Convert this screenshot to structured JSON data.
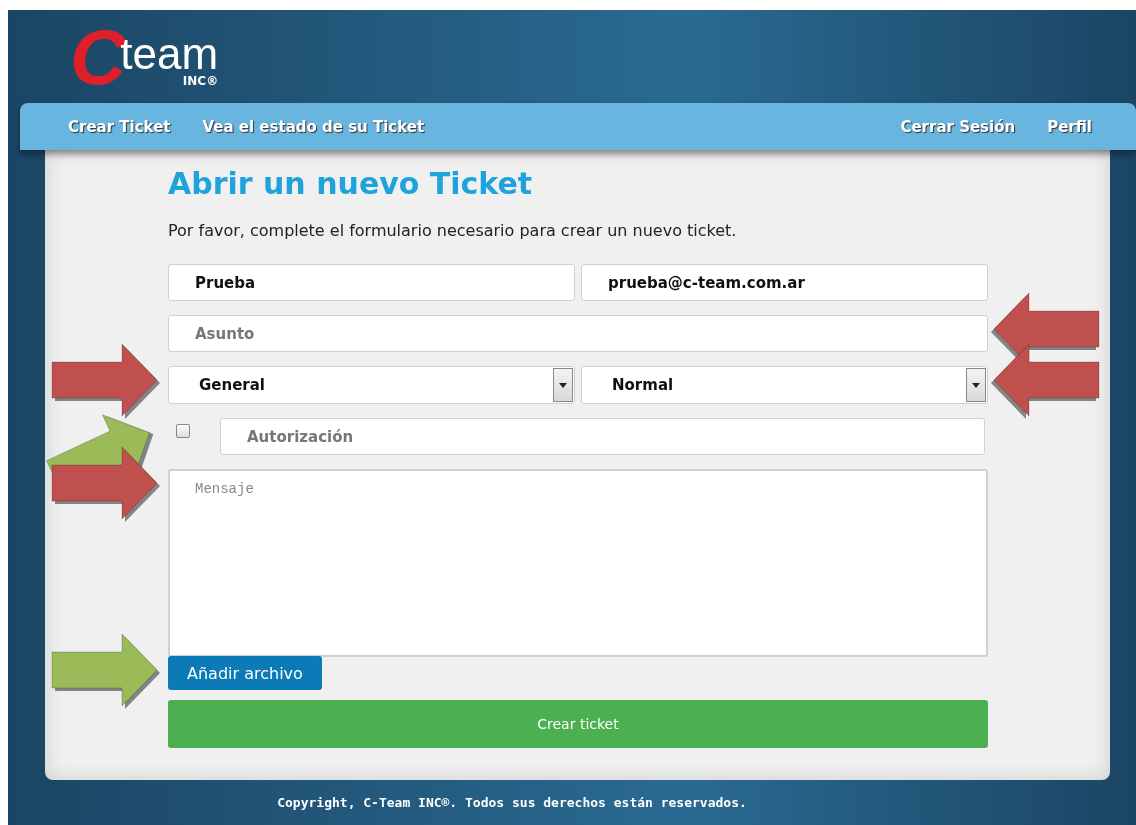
{
  "logo": {
    "letter": "C",
    "word": "team",
    "suffix": "INC®"
  },
  "nav": {
    "left": [
      {
        "label": "Crear Ticket"
      },
      {
        "label": "Vea el estado de su Ticket"
      }
    ],
    "right": [
      {
        "label": "Cerrar Sesión"
      },
      {
        "label": "Perfil"
      }
    ]
  },
  "form": {
    "title": "Abrir un nuevo Ticket",
    "intro": "Por favor, complete el formulario necesario para crear un nuevo ticket.",
    "name": {
      "value": "Prueba"
    },
    "email": {
      "value": "prueba@c-team.com.ar"
    },
    "subject": {
      "placeholder": "Asunto",
      "arrow": {
        "color": "#c0504d",
        "kind": "leftward"
      }
    },
    "category": {
      "value": "General",
      "arrow": {
        "color": "#c0504d",
        "kind": "rightward"
      }
    },
    "priority": {
      "value": "Normal",
      "arrow": {
        "color": "#c0504d",
        "kind": "leftward"
      }
    },
    "authorization": {
      "checked": false,
      "placeholder": "Autorización",
      "arrow": {
        "color": "#9bbb59",
        "kind": "diagonal"
      }
    },
    "message": {
      "placeholder": "Mensaje",
      "arrow": {
        "color": "#c0504d",
        "kind": "rightward"
      }
    },
    "attach_button": {
      "label": "Añadir archivo",
      "arrow": {
        "color": "#9bbb59",
        "kind": "rightward"
      }
    },
    "submit_button": {
      "label": "Crear ticket"
    }
  },
  "footer": "Copyright, C-Team INC®. Todos sus derechos están reservados."
}
